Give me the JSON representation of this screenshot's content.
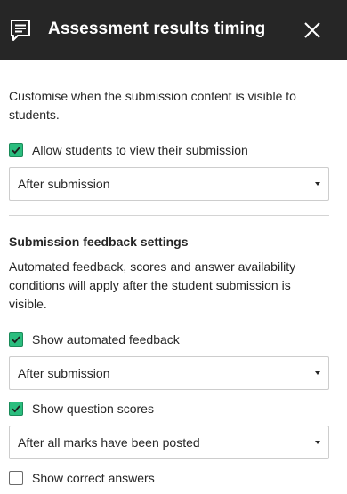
{
  "header": {
    "title": "Assessment results timing",
    "icon": "comment-icon",
    "close_icon": "close-icon"
  },
  "intro_text": "Customise when the submission content is visible to students.",
  "allow_view": {
    "label": "Allow students to view their submission",
    "checked": true,
    "select_value": "After submission"
  },
  "feedback": {
    "heading": "Submission feedback settings",
    "description": "Automated feedback, scores and answer availability conditions will apply after the student submission is visible.",
    "automated_feedback": {
      "label": "Show automated feedback",
      "checked": true,
      "select_value": "After submission"
    },
    "question_scores": {
      "label": "Show question scores",
      "checked": true,
      "select_value": "After all marks have been posted"
    },
    "correct_answers": {
      "label": "Show correct answers",
      "checked": false
    }
  },
  "colors": {
    "header_bg": "#262626",
    "checkbox_checked": "#2bbd7e",
    "text": "#262626"
  }
}
